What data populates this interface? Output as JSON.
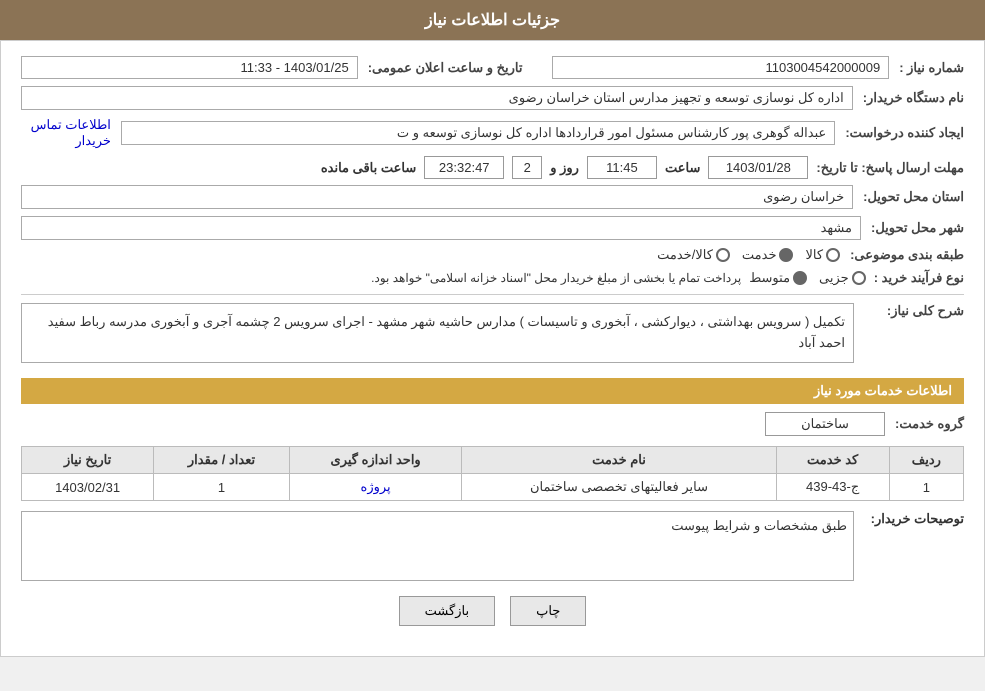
{
  "header": {
    "title": "جزئیات اطلاعات نیاز"
  },
  "fields": {
    "need_number_label": "شماره نیاز :",
    "need_number_value": "1103004542000009",
    "date_label": "تاریخ و ساعت اعلان عمومی:",
    "date_value": "1403/01/25 - 11:33",
    "buyer_name_label": "نام دستگاه خریدار:",
    "buyer_name_value": "اداره کل نوسازی  توسعه و تجهیز مدارس استان خراسان رضوی",
    "creator_label": "ایجاد کننده درخواست:",
    "creator_value": "عبداله گوهری پور کارشناس مسئول امور قراردادها  اداره کل نوسازی  توسعه و ت",
    "contact_info": "اطلاعات تماس خریدار",
    "deadline_label": "مهلت ارسال پاسخ: تا تاریخ:",
    "deadline_date": "1403/01/28",
    "deadline_time_label": "ساعت",
    "deadline_time": "11:45",
    "deadline_day_label": "روز و",
    "deadline_days": "2",
    "deadline_remaining_label": "ساعت باقی مانده",
    "deadline_remaining": "23:32:47",
    "province_label": "استان محل تحویل:",
    "province_value": "خراسان رضوی",
    "city_label": "شهر محل تحویل:",
    "city_value": "مشهد",
    "category_label": "طبقه بندی موضوعی:",
    "category_options": [
      "کالا",
      "خدمت",
      "کالا/خدمت"
    ],
    "category_selected": "خدمت",
    "process_label": "نوع فرآیند خرید :",
    "process_options": [
      "جزیی",
      "متوسط"
    ],
    "process_selected": "متوسط",
    "process_note": "پرداخت تمام یا بخشی از مبلغ خریدار محل \"اسناد خزانه اسلامی\" خواهد بود.",
    "description_label": "شرح کلی نیاز:",
    "description_value": "تکمیل ( سرویس بهداشتی ، دیوارکشی ، آبخوری و تاسیسات ) مدارس حاشیه شهر مشهد - اجرای سرویس 2 چشمه آجری و آبخوری مدرسه رباط سفید احمد آباد",
    "services_section_label": "اطلاعات خدمات مورد نیاز",
    "service_group_label": "گروه خدمت:",
    "service_group_value": "ساختمان",
    "table": {
      "headers": [
        "ردیف",
        "کد خدمت",
        "نام خدمت",
        "واحد اندازه گیری",
        "تعداد / مقدار",
        "تاریخ نیاز"
      ],
      "rows": [
        {
          "row": "1",
          "code": "ج-43-439",
          "name": "سایر فعالیتهای تخصصی ساختمان",
          "unit": "پروژه",
          "quantity": "1",
          "date": "1403/02/31"
        }
      ]
    },
    "buyer_desc_label": "توصیحات خریدار:",
    "buyer_desc_value": "طبق مشخصات و شرایط پیوست"
  },
  "buttons": {
    "print": "چاپ",
    "back": "بازگشت"
  }
}
